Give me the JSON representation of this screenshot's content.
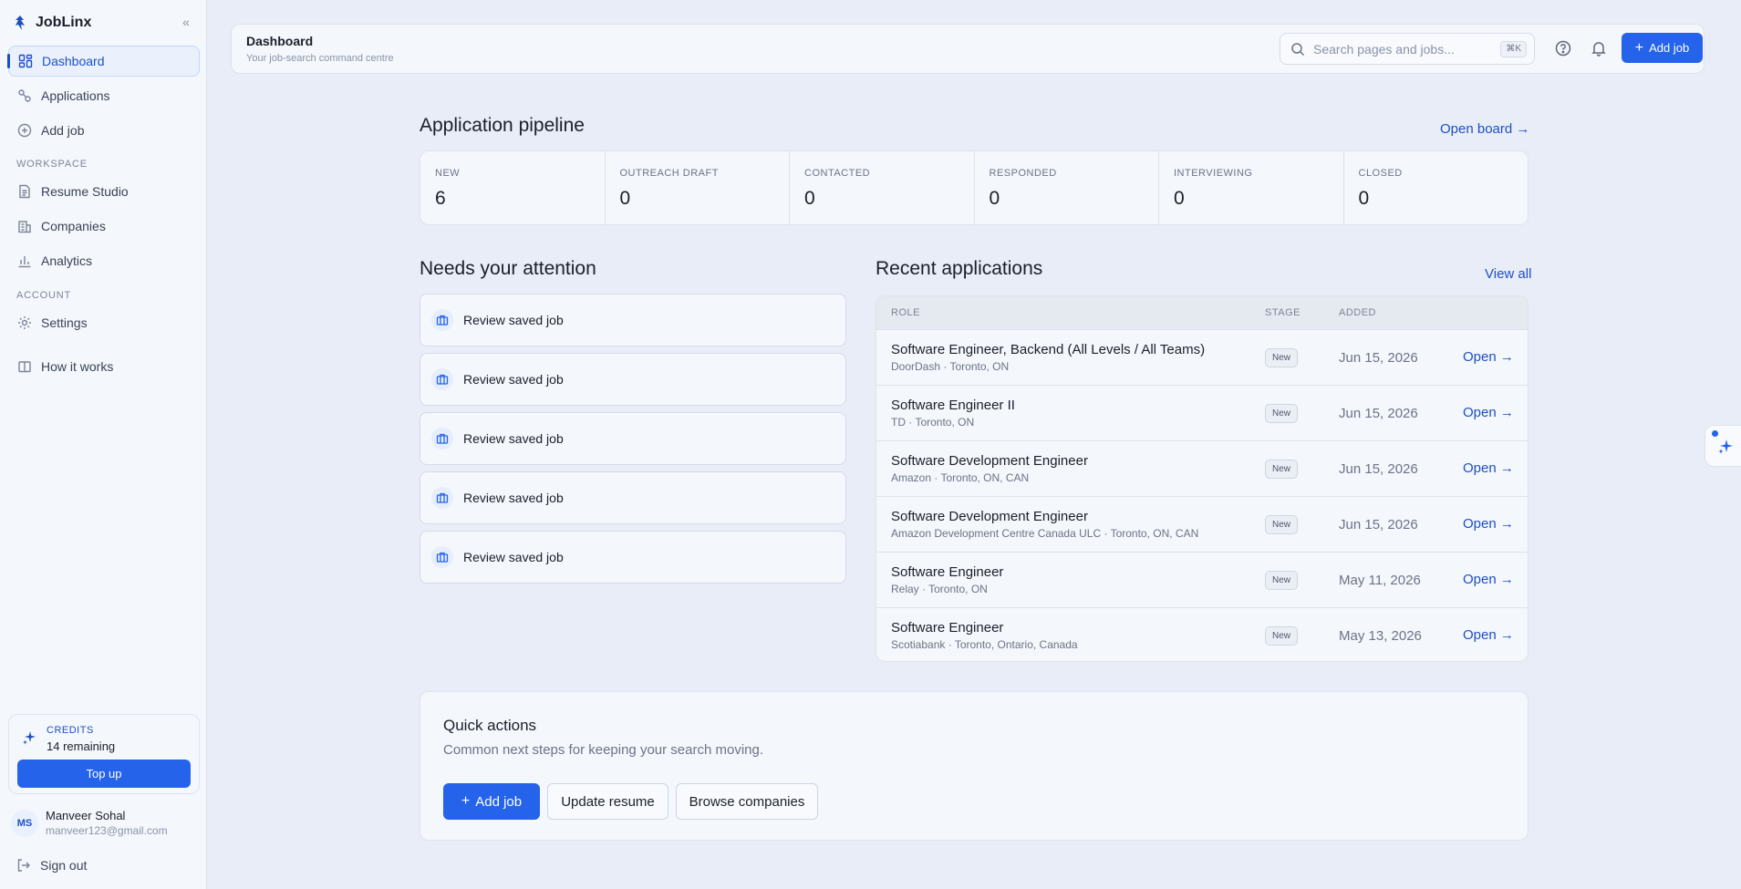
{
  "app": {
    "name": "JobLinx",
    "collapse_icon": "chevrons-left-icon"
  },
  "sidebar": {
    "nav": [
      {
        "label": "Dashboard",
        "icon": "dashboard-grid-icon",
        "active": true
      },
      {
        "label": "Applications",
        "icon": "applications-icon"
      },
      {
        "label": "Add job",
        "icon": "plus-circle-icon"
      }
    ],
    "workspace_label": "WORKSPACE",
    "workspace": [
      {
        "label": "Resume Studio",
        "icon": "document-icon"
      },
      {
        "label": "Companies",
        "icon": "building-icon"
      },
      {
        "label": "Analytics",
        "icon": "bar-chart-icon"
      }
    ],
    "account_label": "ACCOUNT",
    "account": [
      {
        "label": "Settings",
        "icon": "gear-icon"
      }
    ],
    "how_it_works": "How it works",
    "credits": {
      "label": "CREDITS",
      "remaining": "14 remaining",
      "topup": "Top up"
    },
    "user": {
      "initials": "MS",
      "name": "Manveer Sohal",
      "email": "manveer123@gmail.com"
    },
    "signout": "Sign out"
  },
  "header": {
    "title": "Dashboard",
    "subtitle": "Your job-search command centre",
    "search_placeholder": "Search pages and jobs...",
    "search_shortcut": "⌘K",
    "add_job": "Add job"
  },
  "pipeline": {
    "title": "Application pipeline",
    "open_board": "Open board",
    "stages": [
      {
        "label": "NEW",
        "count": "6"
      },
      {
        "label": "OUTREACH DRAFT",
        "count": "0"
      },
      {
        "label": "CONTACTED",
        "count": "0"
      },
      {
        "label": "RESPONDED",
        "count": "0"
      },
      {
        "label": "INTERVIEWING",
        "count": "0"
      },
      {
        "label": "CLOSED",
        "count": "0"
      }
    ]
  },
  "attention": {
    "title": "Needs your attention",
    "items": [
      {
        "label": "Review saved job",
        "icon": "briefcase-icon"
      },
      {
        "label": "Review saved job",
        "icon": "briefcase-icon"
      },
      {
        "label": "Review saved job",
        "icon": "briefcase-icon"
      },
      {
        "label": "Review saved job",
        "icon": "briefcase-icon"
      },
      {
        "label": "Review saved job",
        "icon": "briefcase-icon"
      }
    ]
  },
  "recent": {
    "title": "Recent applications",
    "view_all": "View all",
    "columns": {
      "role": "ROLE",
      "stage": "STAGE",
      "added": "ADDED"
    },
    "rows": [
      {
        "title": "Software Engineer, Backend (All Levels / All Teams)",
        "subtitle": "DoorDash · Toronto, ON",
        "stage": "New",
        "added": "Jun 15, 2026",
        "action": "Open"
      },
      {
        "title": "Software Engineer II",
        "subtitle": "TD · Toronto, ON",
        "stage": "New",
        "added": "Jun 15, 2026",
        "action": "Open"
      },
      {
        "title": "Software Development Engineer",
        "subtitle": "Amazon · Toronto, ON, CAN",
        "stage": "New",
        "added": "Jun 15, 2026",
        "action": "Open"
      },
      {
        "title": "Software Development Engineer",
        "subtitle": "Amazon Development Centre Canada ULC · Toronto, ON, CAN",
        "stage": "New",
        "added": "Jun 15, 2026",
        "action": "Open"
      },
      {
        "title": "Software Engineer",
        "subtitle": "Relay · Toronto, ON",
        "stage": "New",
        "added": "May 11, 2026",
        "action": "Open"
      },
      {
        "title": "Software Engineer",
        "subtitle": "Scotiabank · Toronto, Ontario, Canada",
        "stage": "New",
        "added": "May 13, 2026",
        "action": "Open"
      }
    ]
  },
  "quick_actions": {
    "title": "Quick actions",
    "subtitle": "Common next steps for keeping your search moving.",
    "add_job": "Add job",
    "update_resume": "Update resume",
    "browse_companies": "Browse companies"
  },
  "colors": {
    "accent": "#2563eb",
    "accent_text": "#1d4fc4",
    "background": "#e9edf7",
    "card": "#f4f7fc"
  }
}
